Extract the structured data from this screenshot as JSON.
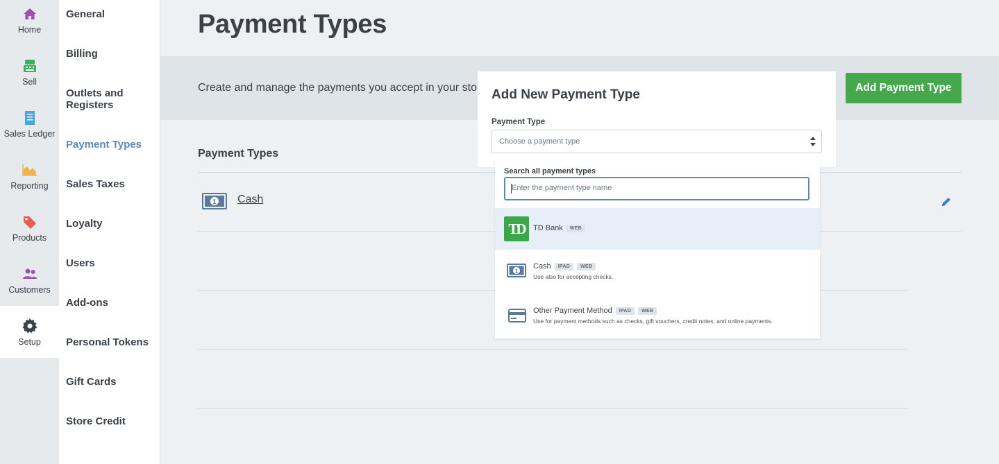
{
  "rail": {
    "items": [
      {
        "label": "Home",
        "icon": "home-icon",
        "color": "#9c4fb5"
      },
      {
        "label": "Sell",
        "icon": "register-icon",
        "color": "#3fae5d"
      },
      {
        "label": "Sales Ledger",
        "icon": "receipt-icon",
        "color": "#4aa8d8"
      },
      {
        "label": "Reporting",
        "icon": "chart-area-icon",
        "color": "#f0b24a"
      },
      {
        "label": "Products",
        "icon": "tags-icon",
        "color": "#e85d4f"
      },
      {
        "label": "Customers",
        "icon": "users-icon",
        "color": "#9c4fb5"
      },
      {
        "label": "Setup",
        "icon": "gear-icon",
        "color": "#3a4149"
      }
    ],
    "active": "Setup"
  },
  "nav": {
    "items": [
      "General",
      "Billing",
      "Outlets and Registers",
      "Payment Types",
      "Sales Taxes",
      "Loyalty",
      "Users",
      "Add-ons",
      "Personal Tokens",
      "Gift Cards",
      "Store Credit"
    ],
    "active": "Payment Types"
  },
  "page": {
    "title": "Payment Types",
    "description": "Create and manage the payments you accept in your stores.",
    "add_button": "Add Payment Type",
    "section_title": "Payment Types",
    "rows": [
      {
        "label": "Cash",
        "icon": "cash-icon"
      }
    ]
  },
  "modal": {
    "title": "Add New Payment Type",
    "field_label": "Payment Type",
    "select_placeholder": "Choose a payment type"
  },
  "dropdown": {
    "search_label": "Search all payment types",
    "search_placeholder": "Enter the payment type name",
    "options": [
      {
        "name": "TD Bank",
        "badges": [
          "WEB"
        ],
        "description": "",
        "icon": "td-bank-logo",
        "highlighted": true
      },
      {
        "name": "Cash",
        "badges": [
          "IPAD",
          "WEB"
        ],
        "description": "Use also for accepting checks.",
        "icon": "cash-icon",
        "highlighted": false
      },
      {
        "name": "Other Payment Method",
        "badges": [
          "IPAD",
          "WEB"
        ],
        "description": "Use for payment methods such as checks, gift vouchers, credit notes, and online payments.",
        "icon": "credit-card-icon",
        "highlighted": false
      }
    ],
    "td_logo_text": "TD"
  },
  "colors": {
    "accent_green": "#45a84b",
    "active_nav": "#5b8ab8",
    "icon_blue": "#5b7a99"
  }
}
